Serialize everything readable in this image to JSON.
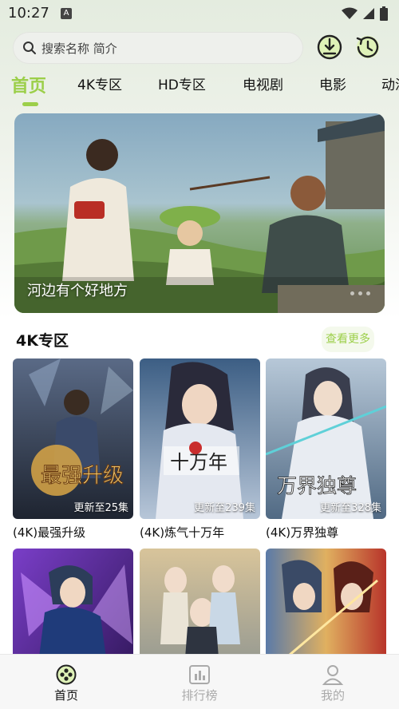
{
  "status_bar": {
    "time": "10:27",
    "notification_glyph": "A",
    "icons": [
      "wifi-icon",
      "signal-icon",
      "battery-icon"
    ]
  },
  "search": {
    "placeholder": "搜索名称 简介"
  },
  "header_buttons": [
    "download-icon",
    "history-icon"
  ],
  "tabs": [
    {
      "label": "首页",
      "active": true
    },
    {
      "label": "4K专区"
    },
    {
      "label": "HD专区"
    },
    {
      "label": "电视剧"
    },
    {
      "label": "电影"
    },
    {
      "label": "动漫"
    }
  ],
  "banner": {
    "title": "河边有个好地方"
  },
  "section": {
    "title": "4K专区",
    "more_label": "查看更多",
    "cards": [
      {
        "title": "(4K)最强升级",
        "badge": "更新至25集",
        "poster_text": "最强升级"
      },
      {
        "title": "(4K)炼气十万年",
        "badge": "更新至239集",
        "poster_text": "十万年"
      },
      {
        "title": "(4K)万界独尊",
        "badge": "更新至328集",
        "poster_text": "万界独尊"
      },
      {
        "title": "",
        "badge": ""
      },
      {
        "title": "",
        "badge": ""
      },
      {
        "title": "",
        "badge": ""
      }
    ]
  },
  "bottom_nav": [
    {
      "label": "首页",
      "icon": "home-icon",
      "active": true
    },
    {
      "label": "排行榜",
      "icon": "ranking-icon"
    },
    {
      "label": "我的",
      "icon": "profile-icon"
    }
  ],
  "colors": {
    "accent": "#9ccf4a",
    "inactive": "#aaaaaa"
  }
}
